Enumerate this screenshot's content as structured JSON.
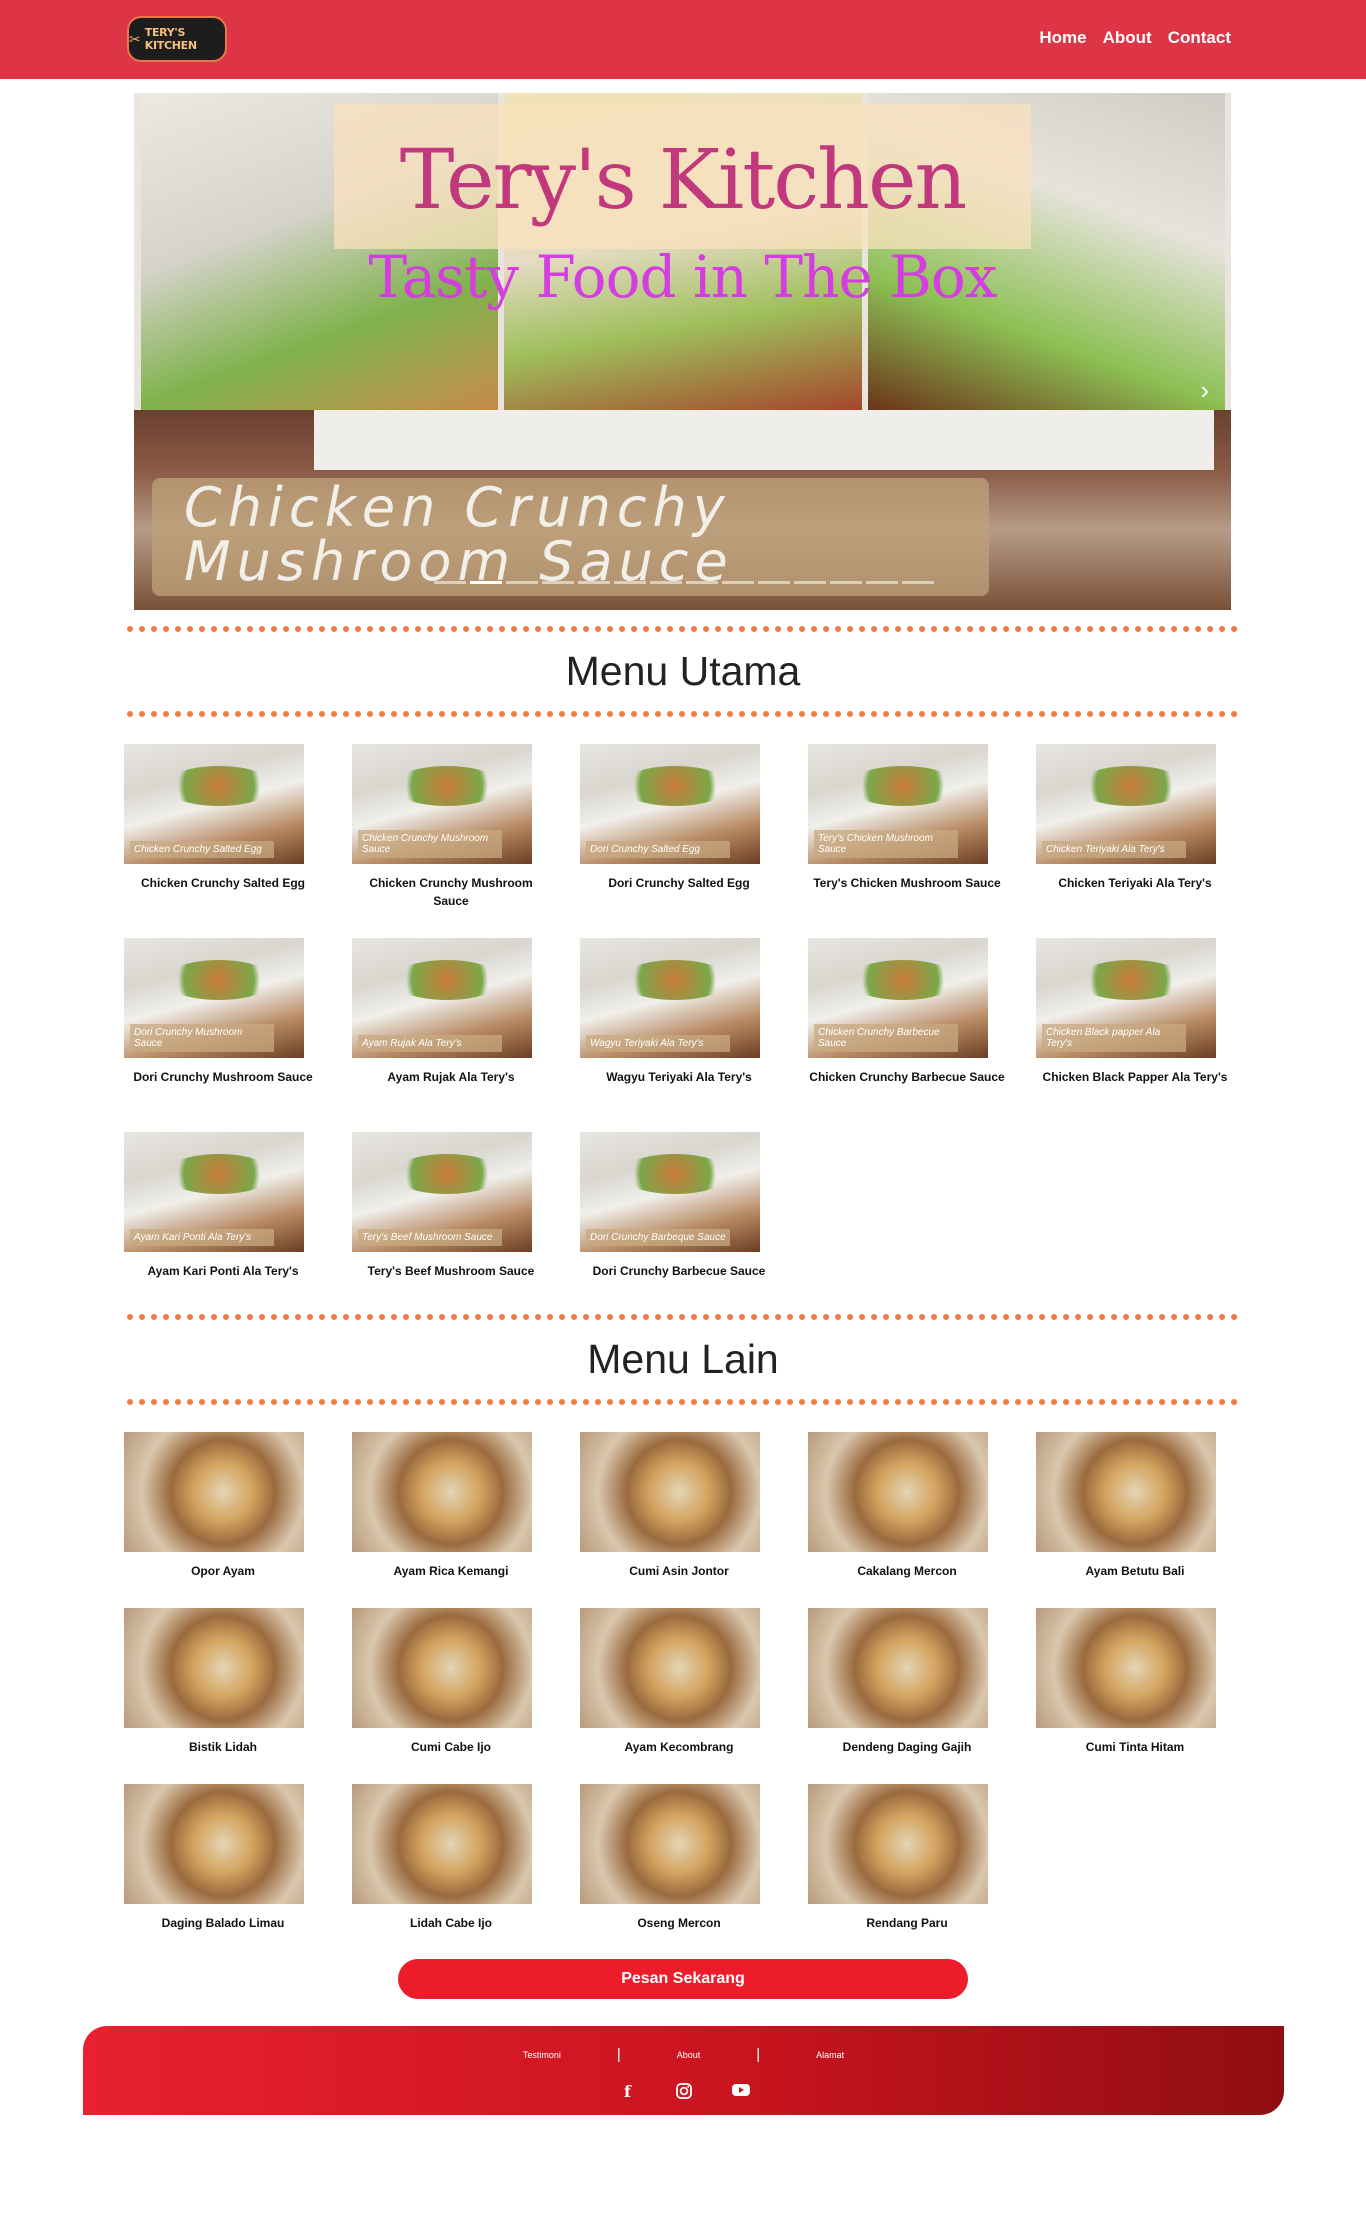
{
  "nav": {
    "logo_text": "TERY'S KITCHEN",
    "links": [
      "Home",
      "About",
      "Contact"
    ]
  },
  "hero": {
    "title": "Tery's Kitchen",
    "subtitle": "Tasty Food in The Box",
    "dish_text": "Chicken Crunchy Mushroom Sauce",
    "slide_count": 14,
    "active_slide": 2
  },
  "menu_utama": {
    "title": "Menu Utama",
    "items": [
      {
        "caption": "Chicken Crunchy Salted Egg",
        "label": "Chicken Crunchy Salted Egg"
      },
      {
        "caption": "Chicken Crunchy Mushroom Sauce",
        "label": "Chicken Crunchy Mushroom Sauce"
      },
      {
        "caption": "Dori Crunchy Salted Egg",
        "label": "Dori Crunchy Salted Egg"
      },
      {
        "caption": "Tery's Chicken Mushroom Sauce",
        "label": "Tery's Chicken Mushroom Sauce"
      },
      {
        "caption": "Chicken Teriyaki Ala Tery's",
        "label": "Chicken Teriyaki Ala Tery's"
      },
      {
        "caption": "Dori Crunchy Mushroom Sauce",
        "label": "Dori Crunchy Mushroom Sauce"
      },
      {
        "caption": "Ayam Rujak Ala Tery's",
        "label": "Ayam Rujak Ala Tery's"
      },
      {
        "caption": "Wagyu Teriyaki Ala Tery's",
        "label": "Wagyu Teriyaki Ala Tery's"
      },
      {
        "caption": "Chicken Crunchy Barbecue Sauce",
        "label": "Chicken Crunchy Barbecue Sauce"
      },
      {
        "caption": "Chicken Black Papper Ala Tery's",
        "label": "Chicken Black papper Ala Tery's"
      },
      {
        "caption": "Ayam Kari Ponti Ala Tery's",
        "label": "Ayam Kari Ponti Ala Tery's"
      },
      {
        "caption": "Tery's Beef Mushroom Sauce",
        "label": "Tery's Beef Mushroom Sauce"
      },
      {
        "caption": "Dori Crunchy Barbecue Sauce",
        "label": "Dori Crunchy Barbeque Sauce"
      }
    ]
  },
  "menu_lain": {
    "title": "Menu Lain",
    "items": [
      {
        "caption": "Opor Ayam"
      },
      {
        "caption": "Ayam Rica Kemangi"
      },
      {
        "caption": "Cumi Asin Jontor"
      },
      {
        "caption": "Cakalang Mercon"
      },
      {
        "caption": "Ayam Betutu Bali"
      },
      {
        "caption": "Bistik Lidah"
      },
      {
        "caption": "Cumi Cabe Ijo"
      },
      {
        "caption": "Ayam Kecombrang"
      },
      {
        "caption": "Dendeng Daging Gajih"
      },
      {
        "caption": "Cumi Tinta Hitam"
      },
      {
        "caption": "Daging Balado Limau"
      },
      {
        "caption": "Lidah Cabe Ijo"
      },
      {
        "caption": "Oseng Mercon"
      },
      {
        "caption": "Rendang Paru"
      }
    ]
  },
  "order_button": "Pesan Sekarang",
  "footer": {
    "links": [
      "Testimoni",
      "About",
      "Alamat"
    ],
    "socials": [
      "facebook-icon",
      "instagram-icon",
      "youtube-icon"
    ]
  },
  "colors": {
    "brand_red": "#dd3545",
    "button_red": "#ec1c2b",
    "dotted_orange": "#f07a40"
  }
}
